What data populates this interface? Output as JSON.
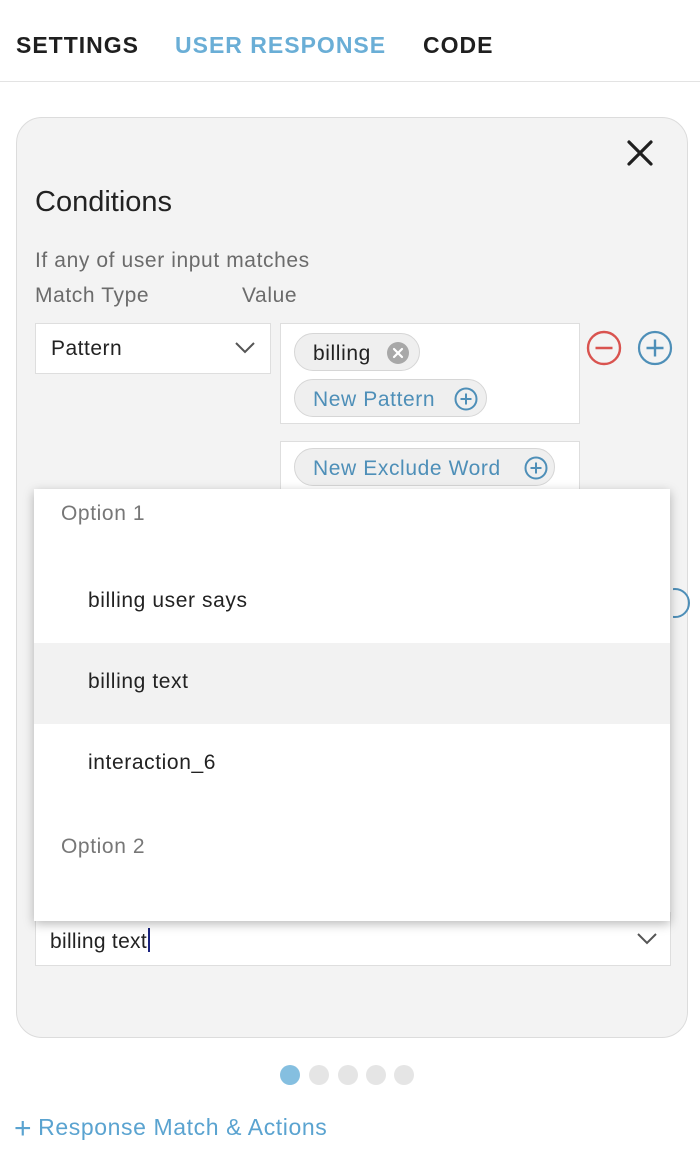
{
  "tabs": [
    {
      "label": "SETTINGS",
      "active": false
    },
    {
      "label": "USER RESPONSE",
      "active": true
    },
    {
      "label": "CODE",
      "active": false
    }
  ],
  "conditions": {
    "title": "Conditions",
    "subtitle": "If any of user input matches",
    "match_type_label": "Match Type",
    "value_label": "Value",
    "match_type_value": "Pattern",
    "patterns": [
      "billing"
    ],
    "new_pattern_label": "New Pattern",
    "new_exclude_label": "New Exclude Word"
  },
  "dropdown": {
    "groups": [
      {
        "label": "Option 1",
        "items": [
          "billing user says",
          "billing text",
          "interaction_6"
        ]
      },
      {
        "label": "Option 2",
        "items": []
      }
    ],
    "highlighted_item": "billing text"
  },
  "bottom_input": {
    "value": "billing text"
  },
  "pagination": {
    "total": 5,
    "active": 1
  },
  "add_link": {
    "label": "Response Match & Actions"
  },
  "colors": {
    "accent": "#5aa3d0",
    "active_tab": "#6aaed6",
    "remove": "#d9534f",
    "card_bg": "#f3f3f3"
  },
  "icons": [
    "close-icon",
    "chevron-down-icon",
    "remove-chip-icon",
    "add-circle-icon",
    "remove-circle-icon",
    "plus-icon"
  ]
}
